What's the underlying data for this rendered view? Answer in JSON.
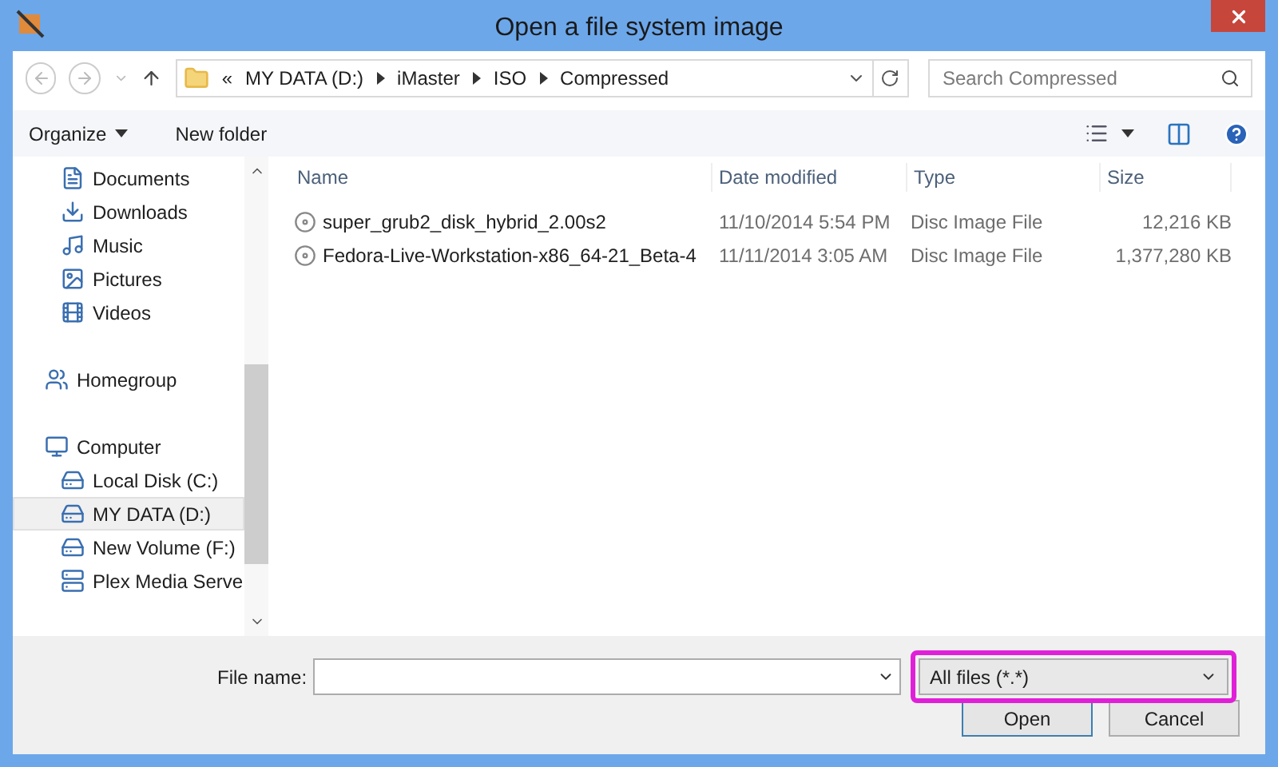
{
  "window": {
    "title": "Open a file system image"
  },
  "address": {
    "prefix": "«",
    "crumbs": [
      "MY DATA (D:)",
      "iMaster",
      "ISO",
      "Compressed"
    ]
  },
  "search": {
    "placeholder": "Search Compressed"
  },
  "toolbar": {
    "organize": "Organize",
    "new_folder": "New folder"
  },
  "sidebar": {
    "libraries": [
      {
        "label": "Documents",
        "selected": false
      },
      {
        "label": "Downloads",
        "selected": false
      },
      {
        "label": "Music",
        "selected": false
      },
      {
        "label": "Pictures",
        "selected": false
      },
      {
        "label": "Videos",
        "selected": false
      }
    ],
    "homegroup": {
      "label": "Homegroup",
      "selected": false
    },
    "computer": {
      "label": "Computer",
      "selected": false,
      "children": [
        {
          "label": "Local Disk (C:)",
          "selected": false
        },
        {
          "label": "MY DATA (D:)",
          "selected": true
        },
        {
          "label": "New Volume (F:)",
          "selected": false
        },
        {
          "label": "Plex Media Serve",
          "selected": false
        }
      ]
    }
  },
  "table": {
    "columns": [
      "Name",
      "Date modified",
      "Type",
      "Size"
    ],
    "rows": [
      {
        "name": "super_grub2_disk_hybrid_2.00s2",
        "date": "11/10/2014 5:54 PM",
        "type": "Disc Image File",
        "size": "12,216 KB"
      },
      {
        "name": "Fedora-Live-Workstation-x86_64-21_Beta-4",
        "date": "11/11/2014 3:05 AM",
        "type": "Disc Image File",
        "size": "1,377,280 KB"
      }
    ]
  },
  "footer": {
    "file_name_label": "File name:",
    "file_type": "All files (*.*)",
    "open": "Open",
    "cancel": "Cancel"
  }
}
